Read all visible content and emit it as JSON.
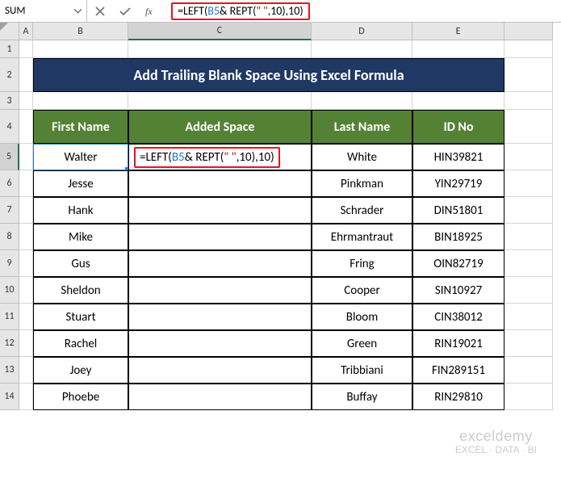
{
  "name_box": "SUM",
  "formula_bar": "=LEFT(B5 & REPT(\" \",10),10)",
  "formula_cell_display": "=LEFT(B5 & REPT(\" \",10),10)",
  "col_headers": [
    "A",
    "B",
    "C",
    "D",
    "E"
  ],
  "row_headers": [
    "1",
    "2",
    "3",
    "4",
    "5",
    "6",
    "7",
    "8",
    "9",
    "10",
    "11",
    "12",
    "13",
    "14"
  ],
  "title": "Add Trailing Blank Space Using Excel Formula",
  "headers": {
    "first": "First Name",
    "added": "Added Space",
    "last": "Last Name",
    "id": "ID No"
  },
  "chart_data": {
    "type": "table",
    "columns": [
      "First Name",
      "Added Space",
      "Last Name",
      "ID No"
    ],
    "rows": [
      {
        "first": "Walter",
        "added": "=LEFT(B5 & REPT(\" \",10),10)",
        "last": "White",
        "id": "HIN39821"
      },
      {
        "first": "Jesse",
        "added": "",
        "last": "Pinkman",
        "id": "YIN29719"
      },
      {
        "first": "Hank",
        "added": "",
        "last": "Schrader",
        "id": "DIN51801"
      },
      {
        "first": "Mike",
        "added": "",
        "last": "Ehrmantraut",
        "id": "BIN18925"
      },
      {
        "first": "Gus",
        "added": "",
        "last": "Fring",
        "id": "OIN82719"
      },
      {
        "first": "Sheldon",
        "added": "",
        "last": "Cooper",
        "id": "SIN10927"
      },
      {
        "first": "Stuart",
        "added": "",
        "last": "Bloom",
        "id": "CIN38012"
      },
      {
        "first": "Rachel",
        "added": "",
        "last": "Green",
        "id": "RIN19021"
      },
      {
        "first": "Joey",
        "added": "",
        "last": "Tribbiani",
        "id": "FIN289151"
      },
      {
        "first": "Phoebe",
        "added": "",
        "last": "Buffay",
        "id": "RIN29810"
      }
    ]
  },
  "watermark": {
    "line1": "exceldemy",
    "line2": "EXCEL · DATA · BI"
  }
}
